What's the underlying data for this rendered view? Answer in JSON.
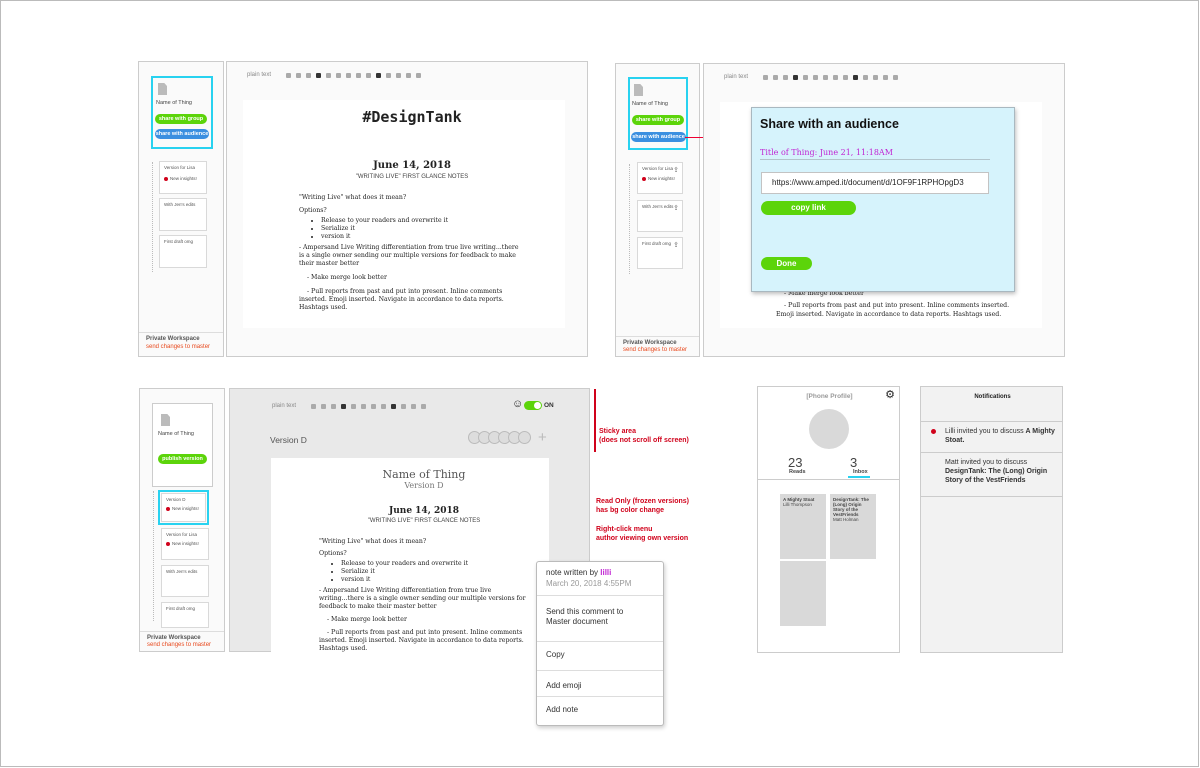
{
  "toolbar": {
    "mode": "plain text"
  },
  "sidebar": {
    "file_name": "Name of Thing",
    "share_group": "share with group",
    "share_audience": "share with audience",
    "publish": "publish version",
    "versions": [
      {
        "label": "Version for Lisa",
        "note": "New insights!"
      },
      {
        "label": "With Jen's edits"
      },
      {
        "label": "First draft omg"
      }
    ],
    "version_d_label": "Version D",
    "workspace": "Private Workspace",
    "send_changes": "send changes to master"
  },
  "document": {
    "title": "#DesignTank",
    "date": "June 14, 2018",
    "subtitle": "\"WRITING LIVE\" FIRST GLANCE NOTES",
    "question": "\"Writing Live\" what does it mean?",
    "options_label": "Options?",
    "options": [
      "Release to your readers and overwrite it",
      "Serialize it",
      "version it"
    ],
    "para1": "- Ampersand Live Writing differentiation from true live writing...there is a single owner sending our multiple versions for feedback to make their master better",
    "para2": "- Make merge look better",
    "para3": "- Pull reports from past and put into present. Inline comments inserted. Emoji inserted. Navigate in accordance to data reports. Hashtags used.",
    "para3_tail": "- Pull reports from past and put into present. Inline comments inserted.",
    "para3_tail2": "Emoji inserted. Navigate in accordance to data reports. Hashtags used.",
    "frozen_title": "Name of Thing",
    "frozen_version": "Version D"
  },
  "share_modal": {
    "title": "Share with an audience",
    "thing_title": "Title of Thing: June 21, 11:18AM",
    "url": "https://www.amped.it/document/d/1OF9F1RPHOpgD3",
    "copy": "copy link",
    "done": "Done"
  },
  "frozen": {
    "version_heading": "Version D",
    "toggle_label": "ON"
  },
  "annotations": {
    "sticky": "Sticky area\n(does not scroll off screen)",
    "readonly": "Read Only (frozen versions)\nhas bg color change",
    "rightclick": "Right-click menu\nauthor viewing own version"
  },
  "context_menu": {
    "note_by": "note written by",
    "author": "lilli",
    "timestamp": "March 20, 2018 4:55PM",
    "send": "Send this comment to\nMaster document",
    "copy": "Copy",
    "emoji": "Add emoji",
    "note": "Add note"
  },
  "phone": {
    "profile": "[Phone Profile]",
    "reads_count": "23",
    "reads_label": "Reads",
    "inbox_count": "3",
    "inbox_label": "Inbox",
    "cards": [
      {
        "title": "A Mighty Stoat",
        "author": "Lilli Thompson"
      },
      {
        "title": "DesignTank: The (Long) Origin Story of the VestFriends",
        "author": "Matt Holman"
      }
    ]
  },
  "notifications": {
    "title": "Notifications",
    "items": [
      {
        "text": "Lilli invited you to discuss",
        "bold": "A Mighty Stoat."
      },
      {
        "text": "Matt invited you to discuss",
        "bold": "DesignTank: The (Long) Origin Story of the VestFriends"
      }
    ]
  },
  "colors": {
    "accent": "#28d2f0",
    "green": "#5cd40a",
    "blue": "#3b8fe0",
    "red": "#d0021b",
    "modal": "#d6f3fc",
    "purple": "#c026d3"
  }
}
